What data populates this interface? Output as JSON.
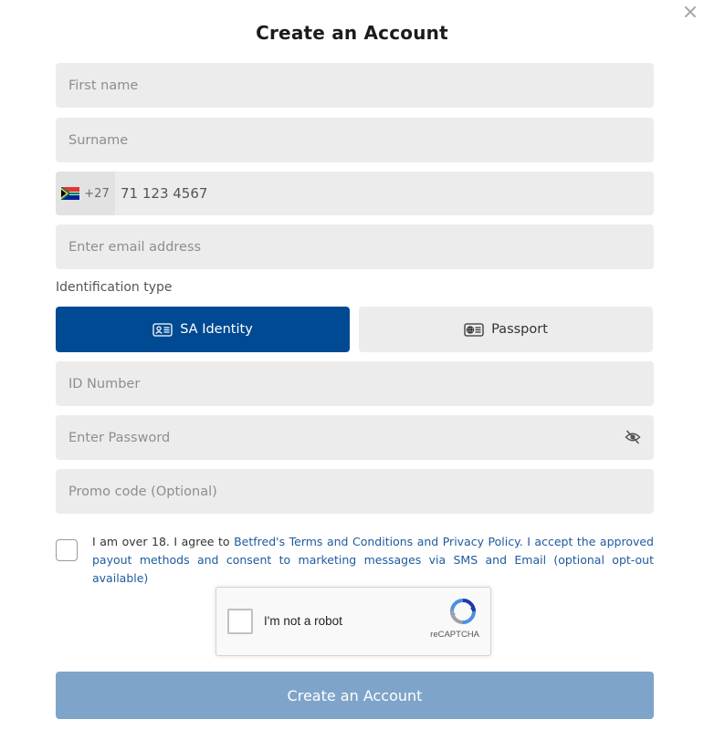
{
  "dialog": {
    "title": "Create an Account",
    "close_icon": "close-icon"
  },
  "form": {
    "first_name": {
      "placeholder": "First name",
      "value": ""
    },
    "surname": {
      "placeholder": "Surname",
      "value": ""
    },
    "phone": {
      "flag_icon": "south-africa-flag-icon",
      "country_code": "+27",
      "value": "71 123 4567"
    },
    "email": {
      "placeholder": "Enter email address",
      "value": ""
    },
    "id_type_label": "Identification type",
    "id_types": [
      {
        "label": "SA Identity",
        "icon": "id-card-icon",
        "selected": true
      },
      {
        "label": "Passport",
        "icon": "passport-icon",
        "selected": false
      }
    ],
    "id_number": {
      "placeholder": "ID Number",
      "value": ""
    },
    "password": {
      "placeholder": "Enter Password",
      "value": "",
      "toggle_icon": "eye-slash-icon"
    },
    "promo": {
      "placeholder": "Promo code (Optional)",
      "value": ""
    },
    "terms": {
      "prefix": "I am over 18. I agree to ",
      "link": "Betfred's Terms and Conditions and Privacy Policy. I accept the approved payout methods and consent to marketing messages via SMS and Email (optional opt-out available)",
      "checked": false
    },
    "captcha": {
      "label": "I'm not a robot",
      "brand": "reCAPTCHA",
      "icon": "recaptcha-logo-icon"
    },
    "submit_label": "Create an Account"
  },
  "colors": {
    "primary": "#004a93",
    "submit_disabled": "#7fa4c9",
    "field_bg": "#ececec",
    "link": "#1f5aa0"
  }
}
